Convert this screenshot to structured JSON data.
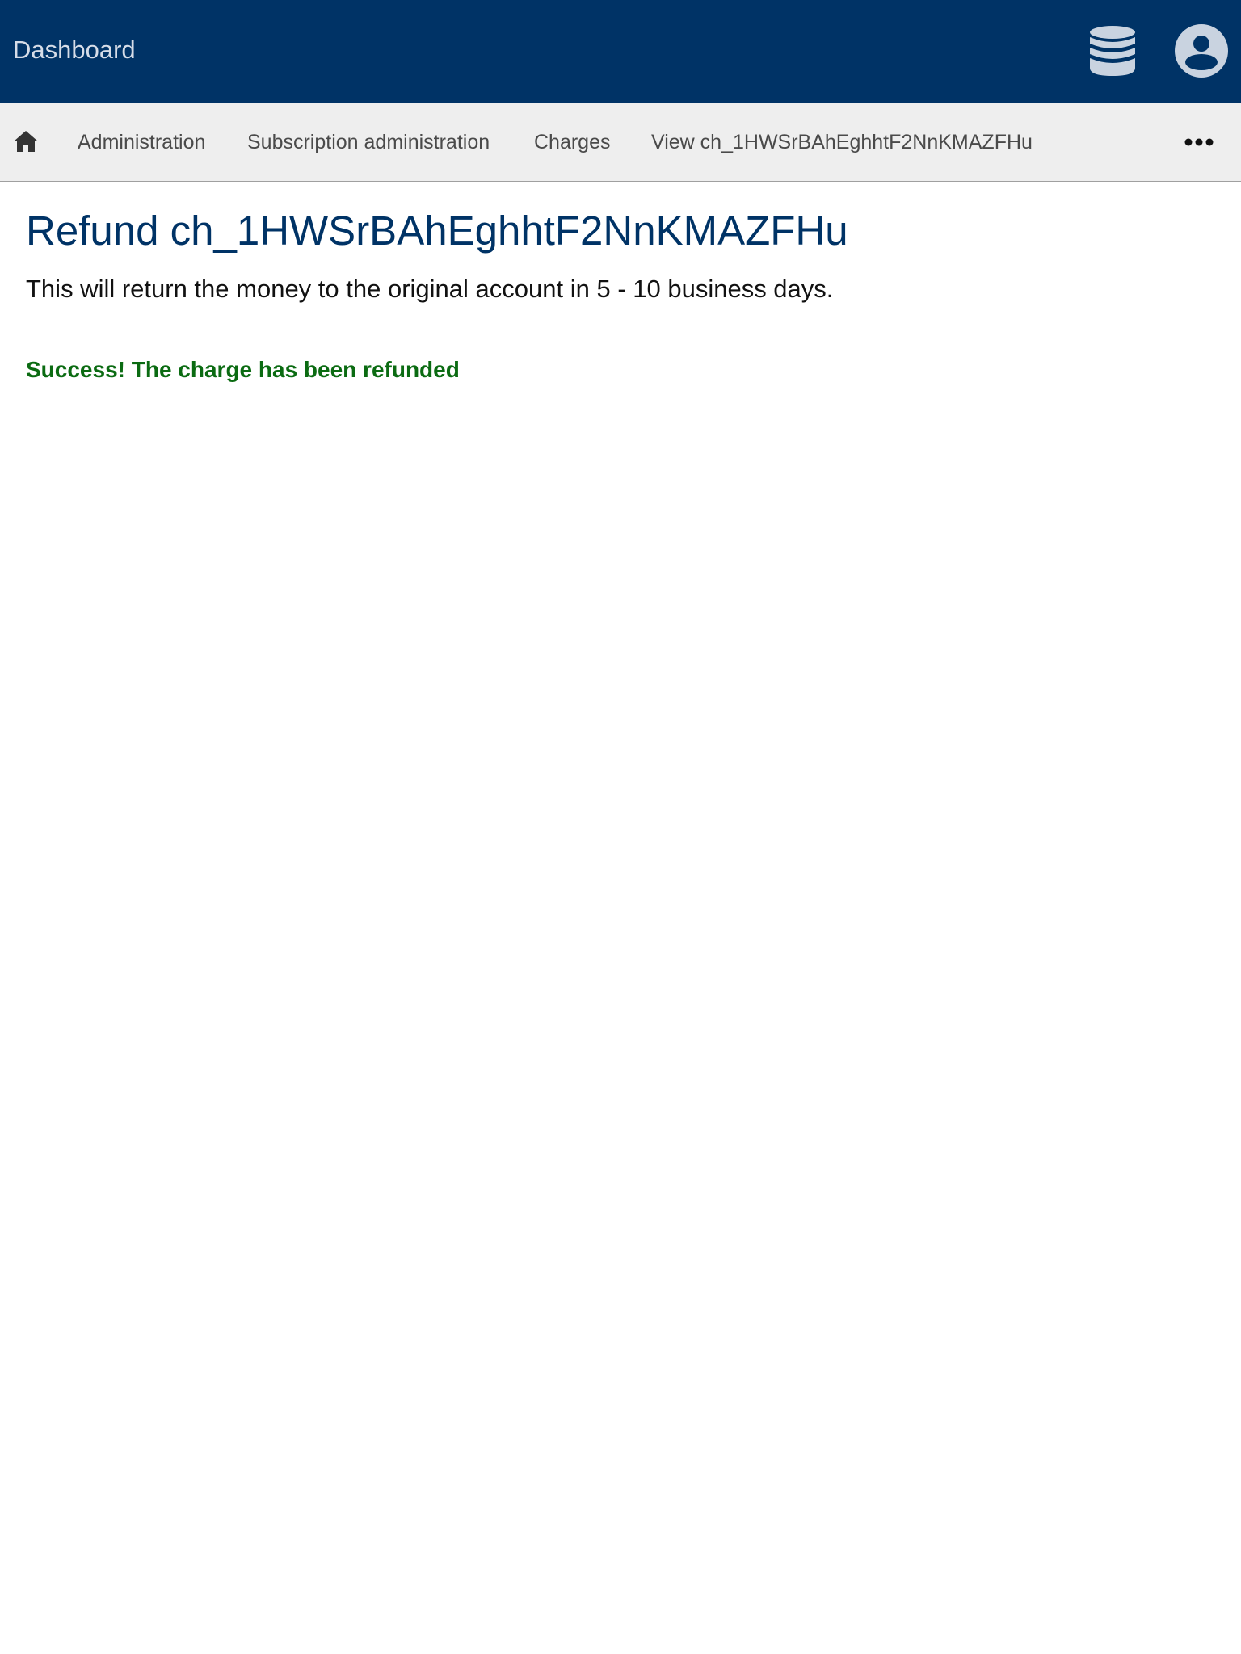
{
  "header": {
    "title": "Dashboard",
    "icons": [
      "database-icon",
      "account-circle-icon"
    ],
    "background_color": "#003366"
  },
  "breadcrumb": {
    "home_icon": "home-icon",
    "items": [
      {
        "label": "Administration"
      },
      {
        "label": "Subscription administration"
      },
      {
        "label": "Charges"
      },
      {
        "label": "View ch_1HWSrBAhEghhtF2NnKMAZFHu"
      }
    ],
    "more_icon": "more-horizontal-icon"
  },
  "main": {
    "title": "Refund ch_1HWSrBAhEghhtF2NnKMAZFHu",
    "description": "This will return the money to the original account in 5 - 10 business days.",
    "success_message": "Success! The charge has been refunded",
    "success_color": "#0b6b12"
  }
}
